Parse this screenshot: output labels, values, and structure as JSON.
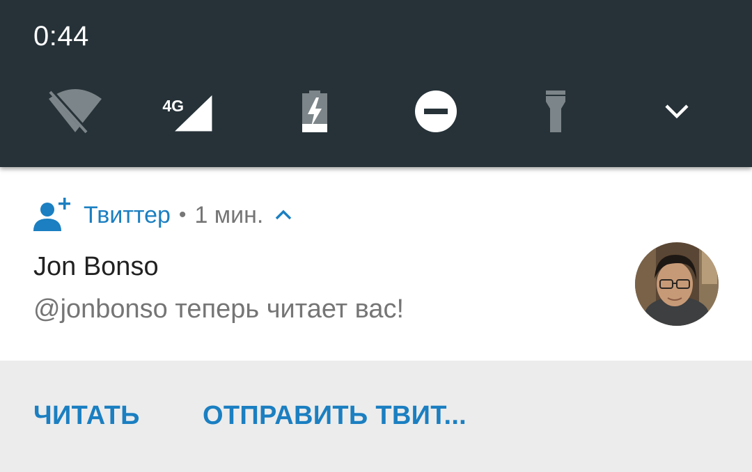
{
  "status_bar": {
    "time": "0:44"
  },
  "quick_settings": {
    "tiles": [
      {
        "icon": "wifi-off-icon",
        "state": "off"
      },
      {
        "icon": "cellular-signal-icon",
        "label": "4G",
        "state": "on"
      },
      {
        "icon": "battery-charging-icon",
        "state": "on"
      },
      {
        "icon": "do-not-disturb-icon",
        "state": "on"
      },
      {
        "icon": "flashlight-icon",
        "state": "off"
      },
      {
        "icon": "chevron-down-icon"
      }
    ]
  },
  "notification": {
    "app_icon": "person-add-icon",
    "app_name": "Твиттер",
    "separator": "•",
    "time": "1 мин.",
    "title": "Jon Bonso",
    "text": "@jonbonso теперь читает вас!",
    "avatar": "user-avatar"
  },
  "actions": {
    "follow": "ЧИТАТЬ",
    "tweet": "ОТПРАВИТЬ ТВИТ..."
  },
  "colors": {
    "shade_bg": "#263238",
    "accent": "#1b7fc1",
    "card_bg": "#ffffff",
    "actions_bg": "#ececec"
  }
}
